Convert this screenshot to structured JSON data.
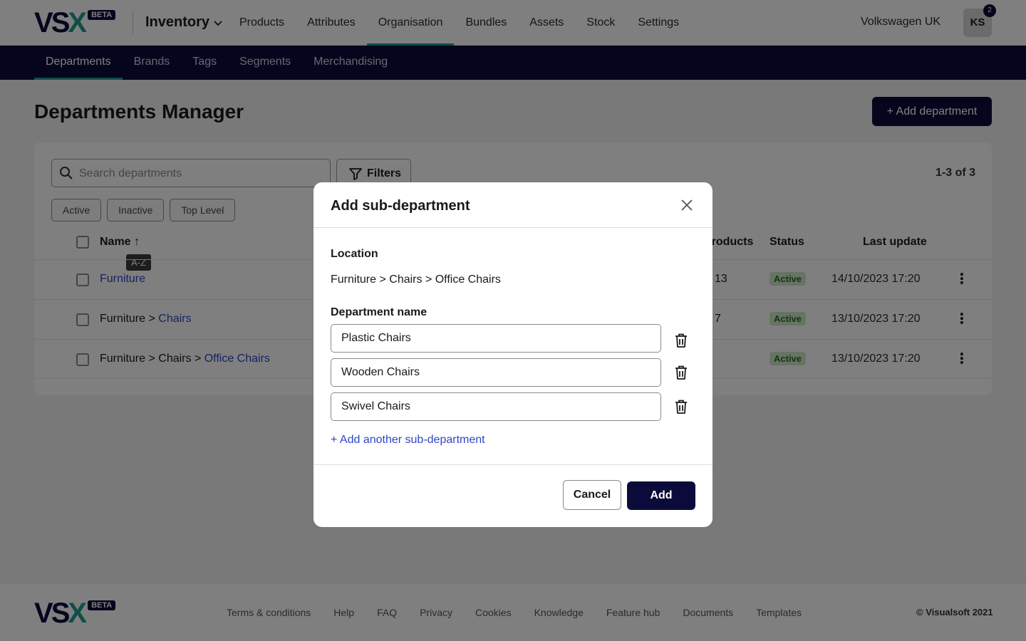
{
  "brand": {
    "logo_letters": [
      "V",
      "S",
      "X"
    ],
    "beta": "BETA",
    "colors": {
      "navy": "#0b0b3b",
      "teal": "#1f9d8e"
    }
  },
  "topnav": {
    "app": "Inventory",
    "items": [
      {
        "label": "Products"
      },
      {
        "label": "Attributes"
      },
      {
        "label": "Organisation",
        "active": true
      },
      {
        "label": "Bundles"
      },
      {
        "label": "Assets"
      },
      {
        "label": "Stock"
      },
      {
        "label": "Settings"
      }
    ],
    "account": "Volkswagen UK",
    "avatar_initials": "KS",
    "notification_count": "2"
  },
  "subnav": {
    "items": [
      {
        "label": "Departments",
        "active": true
      },
      {
        "label": "Brands"
      },
      {
        "label": "Tags"
      },
      {
        "label": "Segments"
      },
      {
        "label": "Merchandising"
      }
    ]
  },
  "page": {
    "title": "Departments Manager",
    "add_button": "+ Add department",
    "search_placeholder": "Search departments",
    "filters_label": "Filters",
    "count": "1-3 of 3",
    "chips": [
      "Active",
      "Inactive",
      "Top Level"
    ]
  },
  "table": {
    "columns": {
      "name": "Name",
      "products": "Products",
      "status": "Status",
      "last_update": "Last update"
    },
    "sort_tooltip": "A-Z",
    "rows": [
      {
        "path_prefix": "",
        "name": "Furniture",
        "products": "13",
        "status": "Active",
        "updated": "14/10/2023 17:20"
      },
      {
        "path_prefix": "Furniture > ",
        "name": "Chairs",
        "products": "7",
        "status": "Active",
        "updated": "13/10/2023 17:20"
      },
      {
        "path_prefix": "Furniture > Chairs > ",
        "name": "Office Chairs",
        "products": "",
        "status": "Active",
        "updated": "13/10/2023 17:20"
      }
    ]
  },
  "modal": {
    "title": "Add sub-department",
    "location_label": "Location",
    "location_value": "Furniture > Chairs > Office Chairs",
    "name_label": "Department name",
    "fields": [
      "Plastic Chairs",
      "Wooden Chairs",
      "Swivel Chairs"
    ],
    "add_another": "+ Add another sub-department",
    "cancel": "Cancel",
    "submit": "Add"
  },
  "footer": {
    "links": [
      "Terms & conditions",
      "Help",
      "FAQ",
      "Privacy",
      "Cookies",
      "Knowledge",
      "Feature hub",
      "Documents",
      "Templates"
    ],
    "copyright": "© Visualsoft 2021"
  }
}
